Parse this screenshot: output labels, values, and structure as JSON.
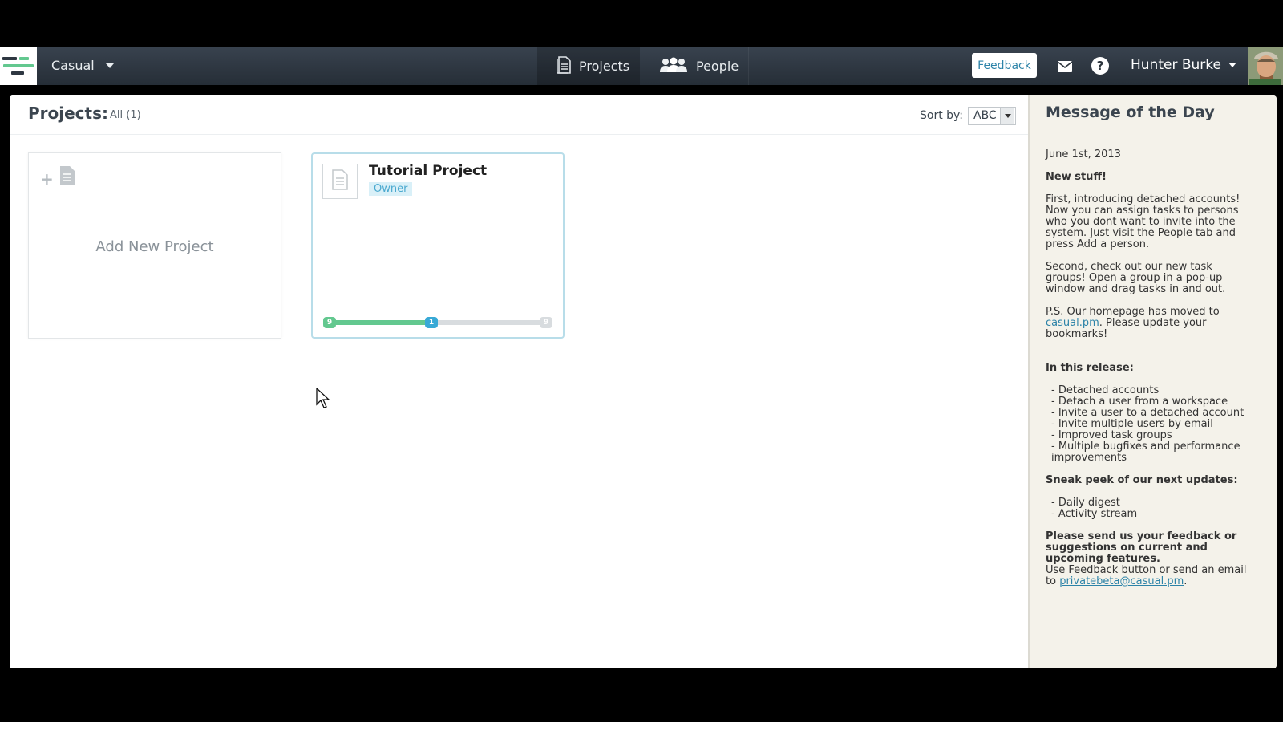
{
  "nav": {
    "workspace": "Casual",
    "tabs": [
      {
        "label": "Projects"
      },
      {
        "label": "People"
      }
    ],
    "feedback_label": "Feedback",
    "user_name": "Hunter Burke"
  },
  "projects": {
    "title": "Projects:",
    "filter": "All (1)",
    "sort_label": "Sort by:",
    "sort_value": "ABC",
    "add_card_label": "Add New Project",
    "items": [
      {
        "title": "Tutorial Project",
        "role": "Owner",
        "progress": {
          "start": "9",
          "current": "1",
          "end": "9",
          "fraction": 0.47
        }
      }
    ]
  },
  "motd": {
    "title": "Message of the Day",
    "date": "June 1st, 2013",
    "heading": "New stuff!",
    "p1": "First, introducing detached accounts! Now you can assign tasks to persons who you dont want to invite into the system. Just visit the People tab and press Add a person.",
    "p2": "Second, check out our new task groups! Open a group in a pop-up window and drag tasks in and out.",
    "p3_prefix": "P.S. Our homepage has moved to",
    "p3_link": "casual.pm",
    "p3_suffix": ". Please update your bookmarks!",
    "release_heading": "In this release:",
    "release_items": [
      "- Detached accounts",
      "- Detach a user from a workspace",
      "- Invite a user to a detached account",
      "- Invite multiple users by email",
      "- Improved task groups",
      "- Multiple bugfixes and performance improvements"
    ],
    "next_heading": "Sneak peek of our next updates:",
    "next_items": [
      "- Daily digest",
      "- Activity stream"
    ],
    "feedback_bold": "Please send us your feedback or suggestions on current and upcoming features.",
    "feedback_text": "Use Feedback button or send an email to",
    "feedback_email": "privatebeta@casual.pm",
    "feedback_end": "."
  },
  "colors": {
    "nav_bg": "#2e3741",
    "accent": "#2c83a8",
    "progress_green": "#63c88f",
    "progress_blue": "#38a9d6",
    "sidebar_bg": "#f4f2ea"
  }
}
